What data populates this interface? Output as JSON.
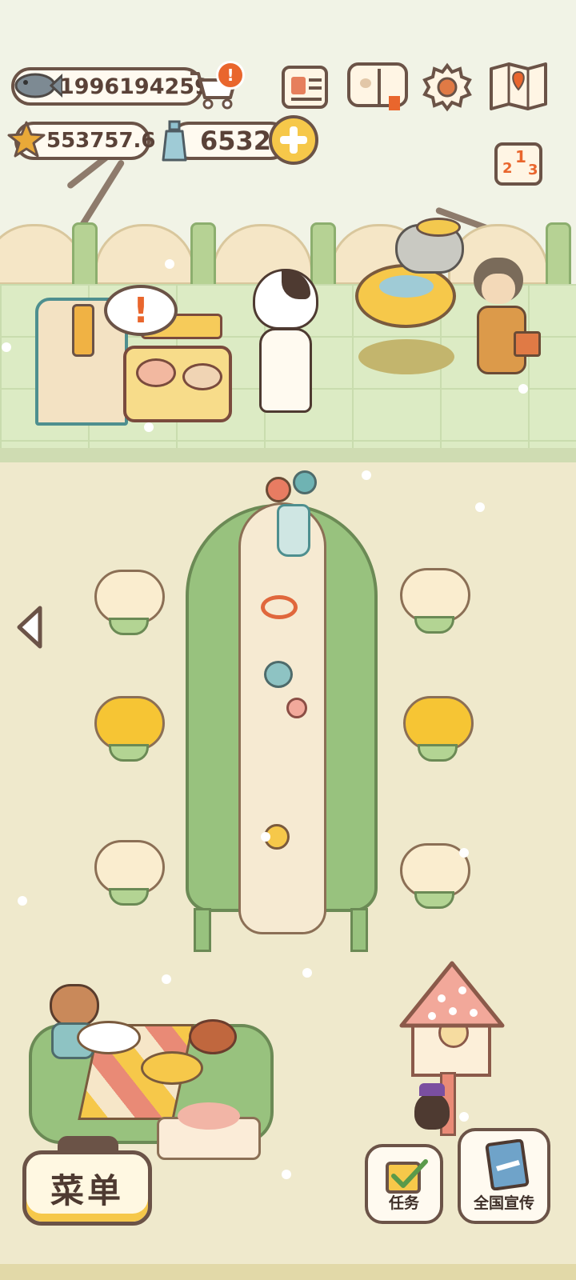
{
  "hud": {
    "fish_currency": "1996194259",
    "star_currency": "553757.6",
    "bottle_currency": "6532",
    "cart_alert": "!"
  },
  "stall": {
    "alert": "!"
  },
  "ranking": {
    "first": "1",
    "second": "2",
    "third": "3"
  },
  "buttons": {
    "menu": "菜单",
    "tasks": "任务",
    "promotion": "全国宣传"
  },
  "colors": {
    "accent_yellow": "#f6c84a",
    "outline": "#6b5347",
    "grass": "#dcebc4",
    "floor": "#efe9cc",
    "table_green": "#98c27e"
  }
}
